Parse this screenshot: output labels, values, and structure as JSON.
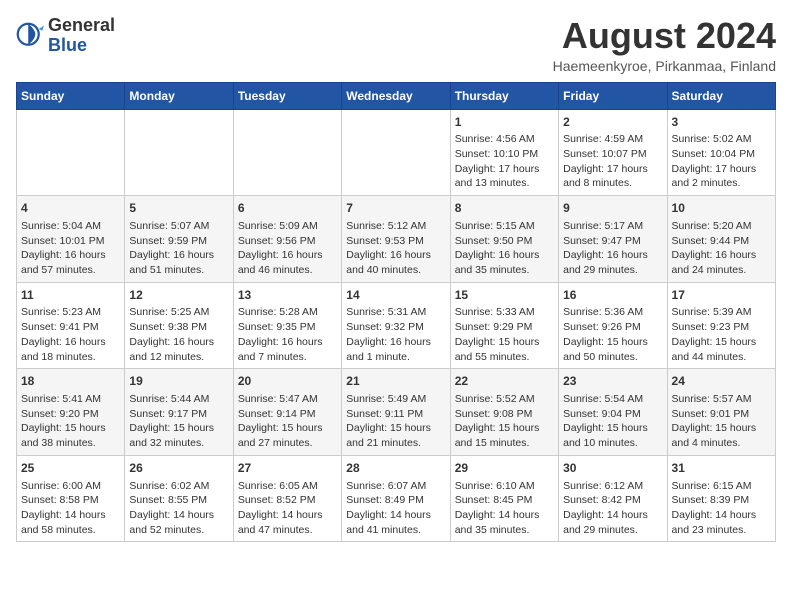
{
  "header": {
    "logo_general": "General",
    "logo_blue": "Blue",
    "month_year": "August 2024",
    "location": "Haemeenkyroe, Pirkanmaa, Finland"
  },
  "days_of_week": [
    "Sunday",
    "Monday",
    "Tuesday",
    "Wednesday",
    "Thursday",
    "Friday",
    "Saturday"
  ],
  "weeks": [
    [
      {
        "day": "",
        "content": ""
      },
      {
        "day": "",
        "content": ""
      },
      {
        "day": "",
        "content": ""
      },
      {
        "day": "",
        "content": ""
      },
      {
        "day": "1",
        "content": "Sunrise: 4:56 AM\nSunset: 10:10 PM\nDaylight: 17 hours\nand 13 minutes."
      },
      {
        "day": "2",
        "content": "Sunrise: 4:59 AM\nSunset: 10:07 PM\nDaylight: 17 hours\nand 8 minutes."
      },
      {
        "day": "3",
        "content": "Sunrise: 5:02 AM\nSunset: 10:04 PM\nDaylight: 17 hours\nand 2 minutes."
      }
    ],
    [
      {
        "day": "4",
        "content": "Sunrise: 5:04 AM\nSunset: 10:01 PM\nDaylight: 16 hours\nand 57 minutes."
      },
      {
        "day": "5",
        "content": "Sunrise: 5:07 AM\nSunset: 9:59 PM\nDaylight: 16 hours\nand 51 minutes."
      },
      {
        "day": "6",
        "content": "Sunrise: 5:09 AM\nSunset: 9:56 PM\nDaylight: 16 hours\nand 46 minutes."
      },
      {
        "day": "7",
        "content": "Sunrise: 5:12 AM\nSunset: 9:53 PM\nDaylight: 16 hours\nand 40 minutes."
      },
      {
        "day": "8",
        "content": "Sunrise: 5:15 AM\nSunset: 9:50 PM\nDaylight: 16 hours\nand 35 minutes."
      },
      {
        "day": "9",
        "content": "Sunrise: 5:17 AM\nSunset: 9:47 PM\nDaylight: 16 hours\nand 29 minutes."
      },
      {
        "day": "10",
        "content": "Sunrise: 5:20 AM\nSunset: 9:44 PM\nDaylight: 16 hours\nand 24 minutes."
      }
    ],
    [
      {
        "day": "11",
        "content": "Sunrise: 5:23 AM\nSunset: 9:41 PM\nDaylight: 16 hours\nand 18 minutes."
      },
      {
        "day": "12",
        "content": "Sunrise: 5:25 AM\nSunset: 9:38 PM\nDaylight: 16 hours\nand 12 minutes."
      },
      {
        "day": "13",
        "content": "Sunrise: 5:28 AM\nSunset: 9:35 PM\nDaylight: 16 hours\nand 7 minutes."
      },
      {
        "day": "14",
        "content": "Sunrise: 5:31 AM\nSunset: 9:32 PM\nDaylight: 16 hours\nand 1 minute."
      },
      {
        "day": "15",
        "content": "Sunrise: 5:33 AM\nSunset: 9:29 PM\nDaylight: 15 hours\nand 55 minutes."
      },
      {
        "day": "16",
        "content": "Sunrise: 5:36 AM\nSunset: 9:26 PM\nDaylight: 15 hours\nand 50 minutes."
      },
      {
        "day": "17",
        "content": "Sunrise: 5:39 AM\nSunset: 9:23 PM\nDaylight: 15 hours\nand 44 minutes."
      }
    ],
    [
      {
        "day": "18",
        "content": "Sunrise: 5:41 AM\nSunset: 9:20 PM\nDaylight: 15 hours\nand 38 minutes."
      },
      {
        "day": "19",
        "content": "Sunrise: 5:44 AM\nSunset: 9:17 PM\nDaylight: 15 hours\nand 32 minutes."
      },
      {
        "day": "20",
        "content": "Sunrise: 5:47 AM\nSunset: 9:14 PM\nDaylight: 15 hours\nand 27 minutes."
      },
      {
        "day": "21",
        "content": "Sunrise: 5:49 AM\nSunset: 9:11 PM\nDaylight: 15 hours\nand 21 minutes."
      },
      {
        "day": "22",
        "content": "Sunrise: 5:52 AM\nSunset: 9:08 PM\nDaylight: 15 hours\nand 15 minutes."
      },
      {
        "day": "23",
        "content": "Sunrise: 5:54 AM\nSunset: 9:04 PM\nDaylight: 15 hours\nand 10 minutes."
      },
      {
        "day": "24",
        "content": "Sunrise: 5:57 AM\nSunset: 9:01 PM\nDaylight: 15 hours\nand 4 minutes."
      }
    ],
    [
      {
        "day": "25",
        "content": "Sunrise: 6:00 AM\nSunset: 8:58 PM\nDaylight: 14 hours\nand 58 minutes."
      },
      {
        "day": "26",
        "content": "Sunrise: 6:02 AM\nSunset: 8:55 PM\nDaylight: 14 hours\nand 52 minutes."
      },
      {
        "day": "27",
        "content": "Sunrise: 6:05 AM\nSunset: 8:52 PM\nDaylight: 14 hours\nand 47 minutes."
      },
      {
        "day": "28",
        "content": "Sunrise: 6:07 AM\nSunset: 8:49 PM\nDaylight: 14 hours\nand 41 minutes."
      },
      {
        "day": "29",
        "content": "Sunrise: 6:10 AM\nSunset: 8:45 PM\nDaylight: 14 hours\nand 35 minutes."
      },
      {
        "day": "30",
        "content": "Sunrise: 6:12 AM\nSunset: 8:42 PM\nDaylight: 14 hours\nand 29 minutes."
      },
      {
        "day": "31",
        "content": "Sunrise: 6:15 AM\nSunset: 8:39 PM\nDaylight: 14 hours\nand 23 minutes."
      }
    ]
  ]
}
